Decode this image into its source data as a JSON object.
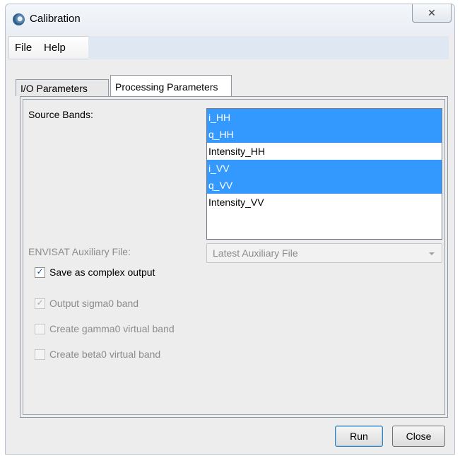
{
  "window": {
    "title": "Calibration",
    "close_glyph": "✕",
    "app_icon": "gear-sphere-icon"
  },
  "menu": {
    "items": [
      "File",
      "Help"
    ]
  },
  "tabs": [
    {
      "label": "I/O Parameters",
      "active": false
    },
    {
      "label": "Processing Parameters",
      "active": true
    }
  ],
  "processing": {
    "source_bands_label": "Source Bands:",
    "bands": [
      {
        "name": "i_HH",
        "selected": true
      },
      {
        "name": "q_HH",
        "selected": true
      },
      {
        "name": "Intensity_HH",
        "selected": false
      },
      {
        "name": "i_VV",
        "selected": true
      },
      {
        "name": "q_VV",
        "selected": true
      },
      {
        "name": "Intensity_VV",
        "selected": false
      }
    ],
    "aux_file_label": "ENVISAT Auxiliary File:",
    "aux_file_value": "Latest Auxiliary File",
    "options": [
      {
        "label": "Save as complex output",
        "checked": true,
        "enabled": true
      },
      {
        "label": "Output sigma0 band",
        "checked": true,
        "enabled": false
      },
      {
        "label": "Create gamma0 virtual band",
        "checked": false,
        "enabled": false
      },
      {
        "label": "Create beta0 virtual band",
        "checked": false,
        "enabled": false
      }
    ]
  },
  "buttons": {
    "run": "Run",
    "close": "Close"
  },
  "colors": {
    "selection": "#3399ff",
    "disabled_text": "#8c8c8c"
  }
}
